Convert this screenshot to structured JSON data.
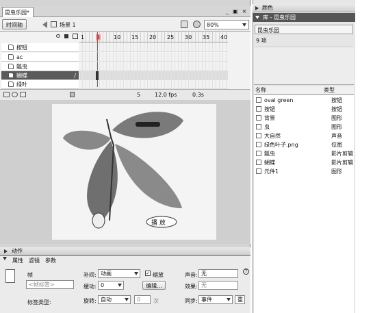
{
  "doc_tab": "昆虫乐园*",
  "window_controls": [
    "_",
    "▣",
    "×"
  ],
  "timeline_btn": "时间轴",
  "scene": "场景 1",
  "zoom": "80%",
  "frame_ticks": [
    "1",
    "5",
    "10",
    "15",
    "20",
    "25",
    "30",
    "35",
    "40"
  ],
  "layers": [
    {
      "name": "按钮",
      "selected": false
    },
    {
      "name": "ac",
      "selected": false
    },
    {
      "name": "瓢虫",
      "selected": false
    },
    {
      "name": "蝴蝶",
      "selected": true
    },
    {
      "name": "绿叶",
      "selected": false
    }
  ],
  "status": {
    "frame": "5",
    "fps": "12.0 fps",
    "time": "0.3s"
  },
  "stage": {
    "play_label": "播 放"
  },
  "panels": {
    "color": "颜色",
    "library": "库 - 昆虫乐园",
    "library_doc": "昆虫乐园",
    "item_count": "9 项",
    "col_name": "名称",
    "col_type": "类型",
    "items": [
      {
        "name": "oval green",
        "type": "按钮"
      },
      {
        "name": "按钮",
        "type": "按钮"
      },
      {
        "name": "背景",
        "type": "图形"
      },
      {
        "name": "虫",
        "type": "图形"
      },
      {
        "name": "大自然",
        "type": "声音"
      },
      {
        "name": "绿色叶子.png",
        "type": "位图"
      },
      {
        "name": "瓢虫",
        "type": "影片剪辑"
      },
      {
        "name": "蝴蝶",
        "type": "影片剪辑"
      },
      {
        "name": "元件1",
        "type": "图形"
      }
    ]
  },
  "actions_label": "动作",
  "props": {
    "tabs": [
      "属性",
      "滤镜",
      "参数"
    ],
    "frame_label": "帧",
    "frame_label_field": "<帧标签>",
    "label_type": "标签类型:",
    "tween_label": "补间:",
    "tween_value": "动画",
    "scale_label": "缩放",
    "ease_label": "缓动:",
    "ease_value": "0",
    "edit_btn": "编辑...",
    "rotate_label": "旋转:",
    "rotate_value": "自动",
    "rotate_count": "0",
    "rotate_unit": "次",
    "sound_label": "声音:",
    "sound_value": "无",
    "effect_label": "效果:",
    "effect_value": "无",
    "sync_label": "同步:",
    "sync_value": "事件",
    "repeat_value": "重"
  }
}
